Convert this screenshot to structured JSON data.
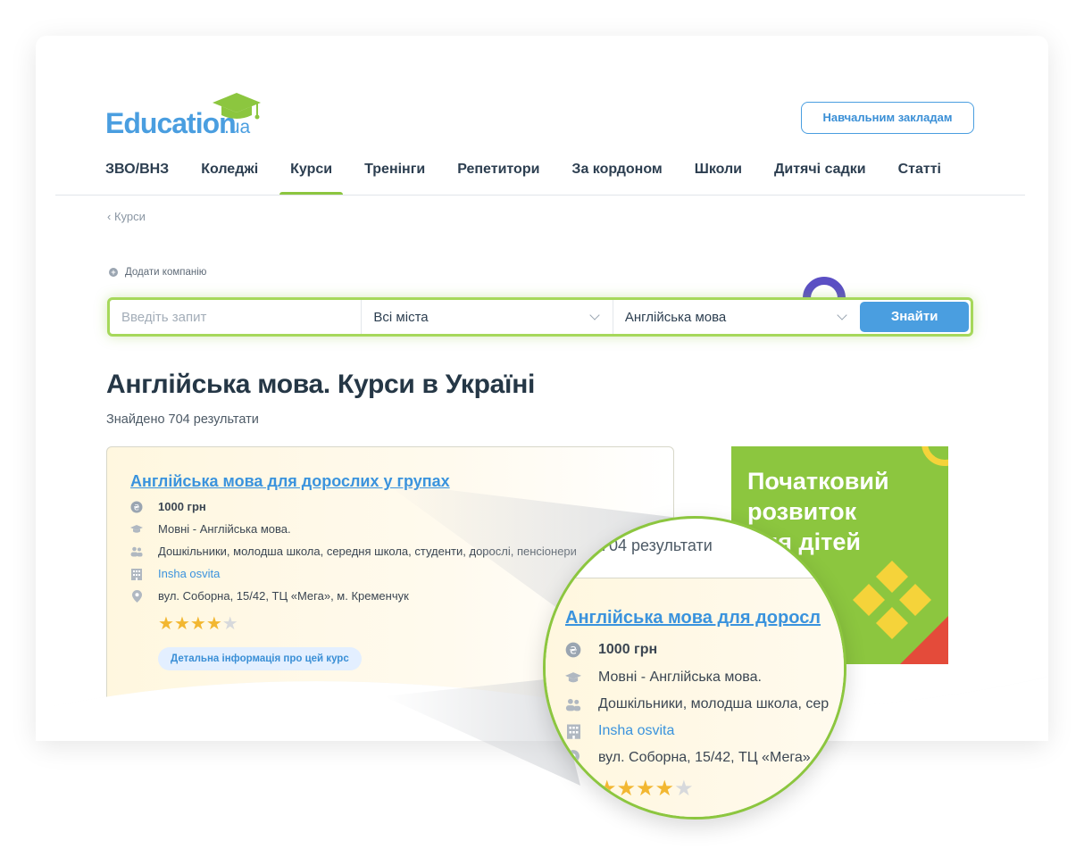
{
  "brand": {
    "logo_word": "Education",
    "logo_suffix": ".ua",
    "green": "#8cc63f",
    "blue": "#4a9ee0"
  },
  "header": {
    "institutions_button": "Навчальним закладам"
  },
  "nav": {
    "items": [
      {
        "label": "ЗВО/ВНЗ"
      },
      {
        "label": "Коледжі"
      },
      {
        "label": "Курси"
      },
      {
        "label": "Тренінги"
      },
      {
        "label": "Репетитори"
      },
      {
        "label": "За кордоном"
      },
      {
        "label": "Школи"
      },
      {
        "label": "Дитячі садки"
      },
      {
        "label": "Статті"
      }
    ],
    "active": "Курси"
  },
  "breadcrumb": {
    "label": "Курси"
  },
  "add_company": {
    "label": "Додати компанію"
  },
  "search": {
    "query_placeholder": "Введіть запит",
    "city_value": "Всі міста",
    "subject_value": "Англійська мова",
    "button": "Знайти"
  },
  "main": {
    "title": "Англійська мова. Курси в Україні",
    "results": "Знайдено 704 результати"
  },
  "course": {
    "title": "Англійська мова для дорослих у групах",
    "price": "1000 грн",
    "category": "Мовні - Англійська мова.",
    "audience": "Дошкільники, молодша школа, середня школа, студенти, дорослі, пенсіонери",
    "company": "Insha osvita",
    "address": "вул. Соборна, 15/42, ТЦ «Мега», м. Кременчук",
    "rating": 4,
    "rating_max": 5,
    "detail_button": "Детальна інформація про цей курс"
  },
  "ad": {
    "text_line1": "Початковий",
    "text_line2": "розвиток",
    "text_line3": "для дітей"
  },
  "magnifier": {
    "results": "о 704 результати",
    "title": "Англійська мова для доросл",
    "price": "1000 грн",
    "category": "Мовні - Англійська мова.",
    "audience": "Дошкільники, молодша школа, сер",
    "company": "Insha osvita",
    "address": "вул. Соборна, 15/42, ТЦ «Мега»"
  }
}
